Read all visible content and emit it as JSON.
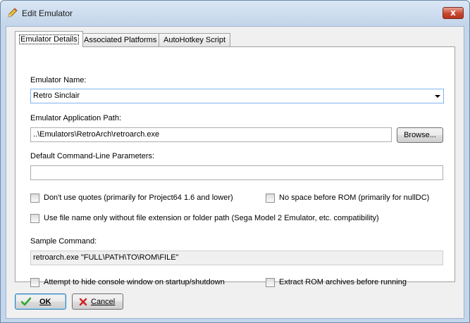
{
  "window": {
    "title": "Edit Emulator",
    "icon": "pencil-icon",
    "close_glyph": "x"
  },
  "tabs": [
    {
      "label": "Emulator Details",
      "active": true
    },
    {
      "label": "Associated Platforms",
      "active": false
    },
    {
      "label": "AutoHotkey Script",
      "active": false
    }
  ],
  "form": {
    "name_label": "Emulator Name:",
    "name_value": "Retro Sinclair",
    "path_label": "Emulator Application Path:",
    "path_value": "..\\Emulators\\RetroArch\\retroarch.exe",
    "browse_label": "Browse...",
    "params_label": "Default Command-Line Parameters:",
    "params_value": "",
    "checkbox_no_quotes": {
      "label": "Don't use quotes (primarily for Project64 1.6 and lower)",
      "checked": false
    },
    "checkbox_no_space": {
      "label": "No space before ROM (primarily for nullDC)",
      "checked": false
    },
    "checkbox_filename_only": {
      "label": "Use file name only without file extension or folder path (Sega Model 2 Emulator, etc. compatibility)",
      "checked": false
    },
    "sample_label": "Sample Command:",
    "sample_value": "retroarch.exe \"FULL\\PATH\\TO\\ROM\\FILE\"",
    "checkbox_hide_console": {
      "label": "Attempt to hide console window on startup/shutdown",
      "checked": false
    },
    "checkbox_extract_rom": {
      "label": "Extract ROM archives before running",
      "checked": false
    }
  },
  "buttons": {
    "ok_label": "OK",
    "cancel_label": "Cancel"
  },
  "colors": {
    "ok_check": "#2fa82f",
    "cancel_x": "#d02020",
    "combo_focus_border": "#7eb4ea"
  }
}
